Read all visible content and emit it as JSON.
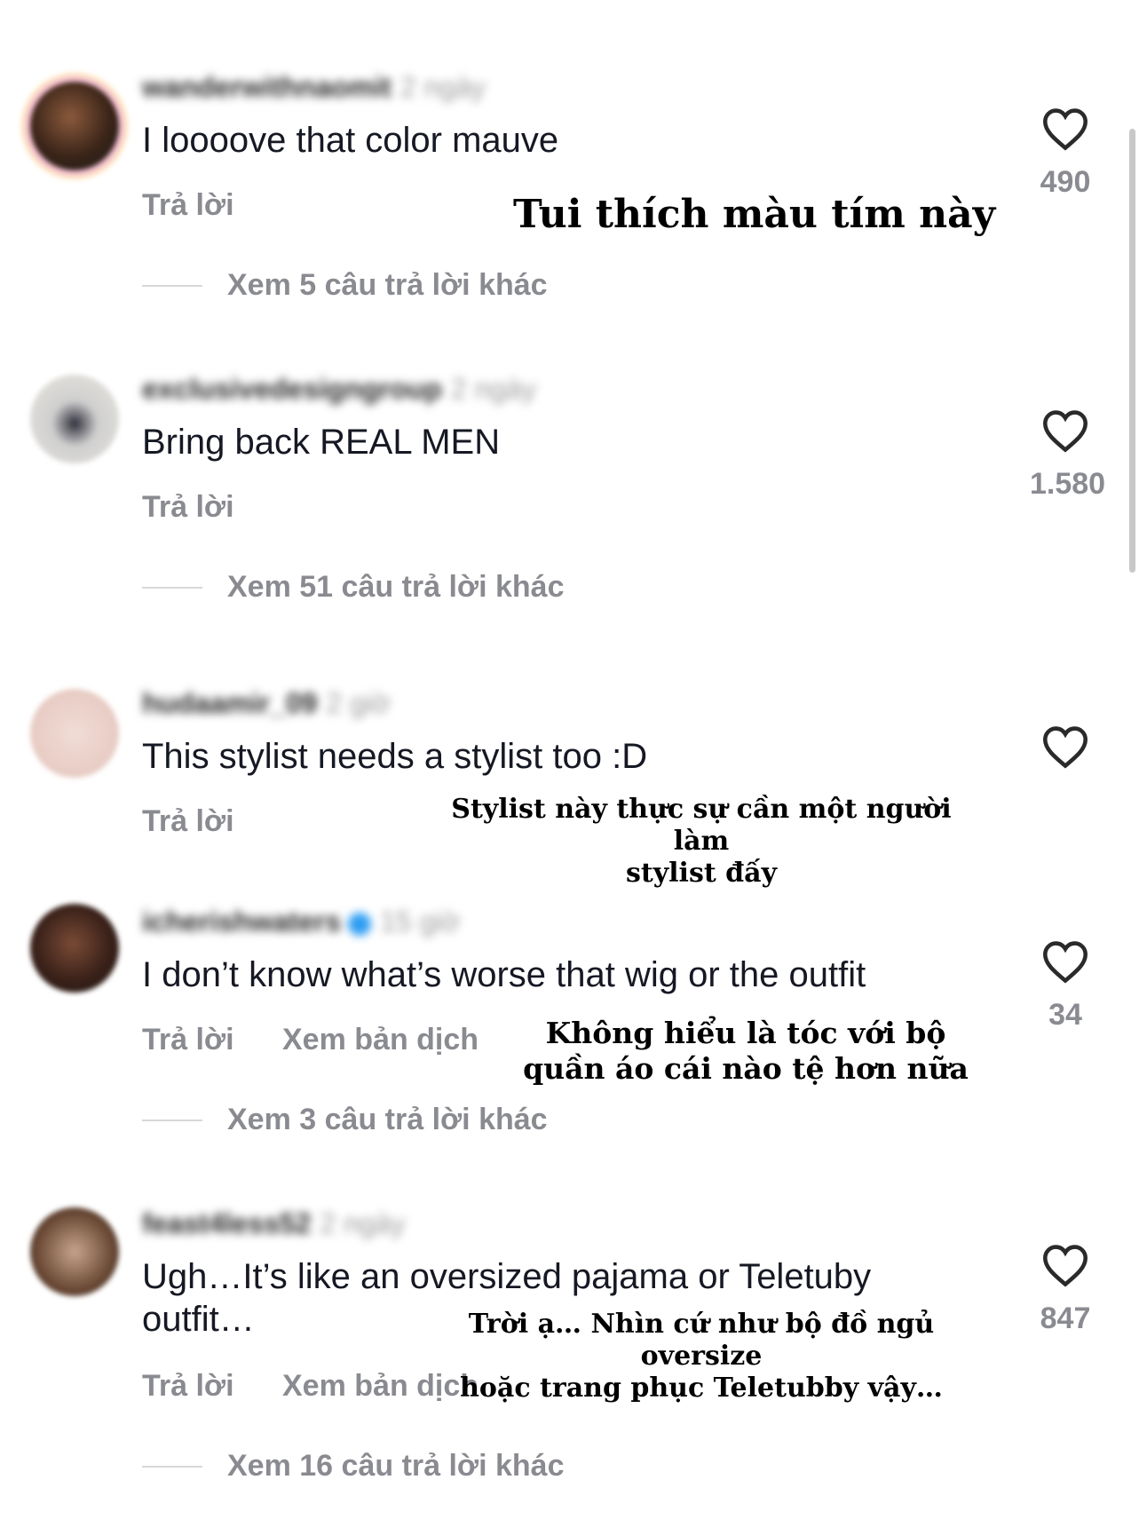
{
  "comments": [
    {
      "username": "wanderwithnaomit",
      "time": "2 ngày",
      "text": "I loooove that color mauve",
      "reply_label": "Trả lời",
      "more_replies": "Xem 5 câu trả lời khác",
      "likes": "490",
      "overlay": "Tui thích màu tím này"
    },
    {
      "username": "exclusivedesigngroup",
      "time": "2 ngày",
      "text": "Bring back REAL MEN",
      "reply_label": "Trả lời",
      "more_replies": "Xem 51 câu trả lời khác",
      "likes": "1.580"
    },
    {
      "username": "hudaamir_09",
      "time": "2 giờ",
      "text": "This stylist needs a stylist too :D",
      "reply_label": "Trả lời",
      "overlay_line1": "Stylist này thực sự cần một người làm",
      "overlay_line2": "stylist đấy"
    },
    {
      "username": "icherishwaters",
      "time": "15 giờ",
      "text": "I don’t know what’s worse that wig or the outfit",
      "reply_label": "Trả lời",
      "translate_label": "Xem bản dịch",
      "more_replies": "Xem 3 câu trả lời khác",
      "likes": "34",
      "overlay_line1": "Không hiểu là tóc với bộ",
      "overlay_line2": "quần áo cái nào tệ hơn nữa"
    },
    {
      "username": "feast4less52",
      "time": "2 ngày",
      "text_line1": "Ugh…It’s like an oversized pajama or Teletuby",
      "text_line2": "outfit…",
      "reply_label": "Trả lời",
      "translate_label": "Xem bản dịch",
      "more_replies": "Xem 16 câu trả lời khác",
      "likes": "847",
      "overlay_line1": "Trời ạ… Nhìn cứ như bộ đồ ngủ oversize",
      "overlay_line2": "hoặc trang phục Teletubby vậy…"
    }
  ],
  "colors": {
    "text": "#161823",
    "secondary": "#8a8b91",
    "verified": "#2d9cf2"
  },
  "icons": {
    "like": "heart-outline-icon",
    "verified": "verified-badge-icon"
  }
}
